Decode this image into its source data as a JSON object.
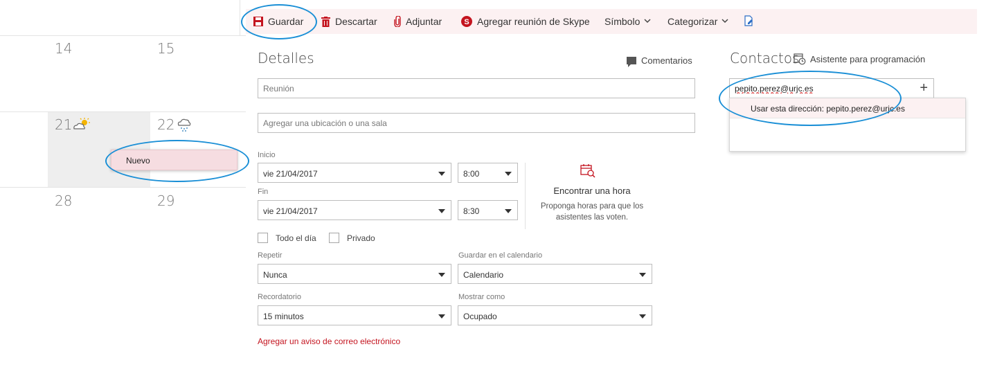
{
  "calendar": {
    "days": [
      "14",
      "15",
      "21",
      "22",
      "28",
      "29"
    ],
    "weather_icons": [
      "partly-sunny-icon",
      "rain-cloud-icon"
    ],
    "context_menu": {
      "new_label": "Nuevo"
    }
  },
  "toolbar": {
    "save_label": "Guardar",
    "discard_label": "Descartar",
    "attach_label": "Adjuntar",
    "skype_label": "Agregar reunión de Skype",
    "symbol_label": "Símbolo",
    "categorize_label": "Categorizar",
    "accent_color": "#c4141f"
  },
  "details": {
    "heading": "Detalles",
    "comments_label": "Comentarios",
    "subject_placeholder": "Reunión",
    "location_placeholder": "Agregar una ubicación o una sala",
    "start": {
      "label": "Inicio",
      "date": "vie 21/04/2017",
      "time": "8:00"
    },
    "end": {
      "label": "Fin",
      "date": "vie 21/04/2017",
      "time": "8:30"
    },
    "all_day_label": "Todo el día",
    "private_label": "Privado",
    "repeat": {
      "label": "Repetir",
      "value": "Nunca"
    },
    "save_calendar": {
      "label": "Guardar en el calendario",
      "value": "Calendario"
    },
    "reminder": {
      "label": "Recordatorio",
      "value": "15 minutos"
    },
    "show_as": {
      "label": "Mostrar como",
      "value": "Ocupado"
    },
    "email_alert_link": "Agregar un aviso de correo electrónico",
    "find_time": {
      "title": "Encontrar una hora",
      "subtitle": "Proponga horas para que los asistentes las voten."
    }
  },
  "contacts": {
    "heading": "Contactos",
    "scheduler_label": "Asistente para programación",
    "input_value": "pepito.perez@urjc.es",
    "suggestion": "Usar esta dirección: pepito.perez@urjc.es"
  }
}
